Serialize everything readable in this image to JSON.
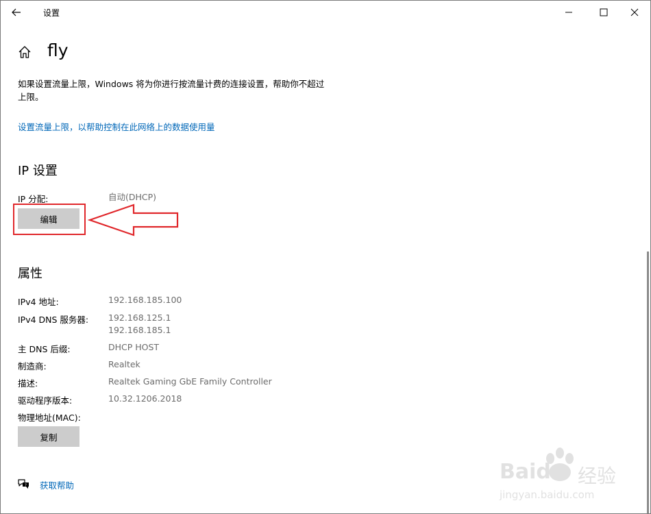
{
  "window": {
    "title": "设置"
  },
  "header": {
    "title": "fly"
  },
  "metered": {
    "description": "如果设置流量上限，Windows 将为你进行按流量计费的连接设置，帮助你不超过上限。",
    "link": "设置流量上限，以帮助控制在此网络上的数据使用量"
  },
  "ip_settings": {
    "title": "IP 设置",
    "assignment_label": "IP 分配:",
    "assignment_value": "自动(DHCP)",
    "edit_label": "编辑"
  },
  "properties": {
    "title": "属性",
    "ipv4_label": "IPv4 地址:",
    "ipv4_value": "192.168.185.100",
    "dns_label": "IPv4 DNS 服务器:",
    "dns_values": [
      "192.168.125.1",
      "192.168.185.1"
    ],
    "dns_suffix_label": "主 DNS 后缀:",
    "dns_suffix_value": "DHCP HOST",
    "manufacturer_label": "制造商:",
    "manufacturer_value": "Realtek",
    "description_label": "描述:",
    "description_value": "Realtek Gaming GbE Family Controller",
    "driver_label": "驱动程序版本:",
    "driver_value": "10.32.1206.2018",
    "mac_label": "物理地址(MAC):",
    "copy_label": "复制"
  },
  "help": {
    "label": "获取帮助"
  },
  "watermark": {
    "brand": "Baidu",
    "cn": "经验",
    "url": "jingyan.baidu.com"
  },
  "colors": {
    "link": "#0067b8",
    "button": "#cccccc",
    "annotation": "#e0262a"
  },
  "icons": {
    "back": "back-arrow-icon",
    "home": "home-icon",
    "help": "chat-help-icon"
  }
}
